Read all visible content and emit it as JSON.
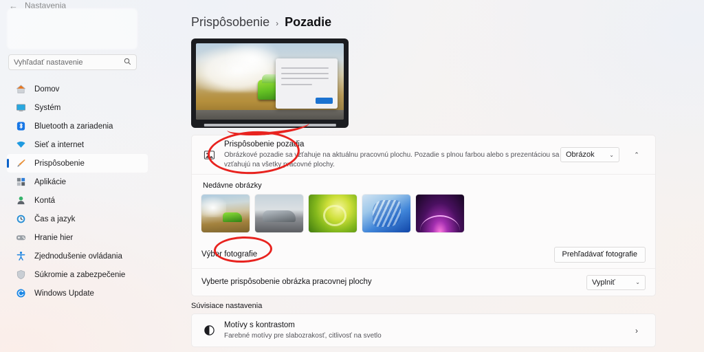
{
  "window": {
    "title": "Nastavenia",
    "back_icon": "back-arrow-icon"
  },
  "sidebar": {
    "search": {
      "placeholder": "Vyhľadať nastavenie",
      "value": "",
      "icon": "search-icon"
    },
    "items": [
      {
        "label": "Domov",
        "icon": "home-icon",
        "selected": false
      },
      {
        "label": "Systém",
        "icon": "monitor-icon",
        "selected": false
      },
      {
        "label": "Bluetooth a zariadenia",
        "icon": "bluetooth-icon",
        "selected": false
      },
      {
        "label": "Sieť a internet",
        "icon": "wifi-icon",
        "selected": false
      },
      {
        "label": "Prispôsobenie",
        "icon": "paintbrush-icon",
        "selected": true
      },
      {
        "label": "Aplikácie",
        "icon": "apps-icon",
        "selected": false
      },
      {
        "label": "Kontá",
        "icon": "person-icon",
        "selected": false
      },
      {
        "label": "Čas a jazyk",
        "icon": "clock-icon",
        "selected": false
      },
      {
        "label": "Hranie hier",
        "icon": "gamepad-icon",
        "selected": false
      },
      {
        "label": "Zjednodušenie ovládania",
        "icon": "accessibility-icon",
        "selected": false
      },
      {
        "label": "Súkromie a zabezpečenie",
        "icon": "shield-icon",
        "selected": false
      },
      {
        "label": "Windows Update",
        "icon": "update-icon",
        "selected": false
      }
    ]
  },
  "breadcrumb": {
    "parent": "Prispôsobenie",
    "separator": "›",
    "current": "Pozadie"
  },
  "preview": {
    "name": "desktop-background-preview"
  },
  "background_settings": {
    "title": "Prispôsobenie pozadia",
    "description": "Obrázkové pozadie sa vzťahuje na aktuálnu pracovnú plochu. Pozadie s plnou farbou alebo s prezentáciou sa vzťahujú na všetky pracovné plochy.",
    "icon": "picture-icon",
    "dropdown_value": "Obrázok",
    "dropdown_chevron": "⌄",
    "expander_chevron": "⌃"
  },
  "recent_images": {
    "label": "Nedávne obrázky",
    "thumbnails": [
      {
        "name": "thumbnail-green-car-smoke"
      },
      {
        "name": "thumbnail-silver-car"
      },
      {
        "name": "thumbnail-green-abstract"
      },
      {
        "name": "thumbnail-windows11-blue-bloom"
      },
      {
        "name": "thumbnail-purple-glow"
      }
    ]
  },
  "choose_photo": {
    "label": "Výber fotografie",
    "button_label": "Prehľadávať fotografie"
  },
  "fit_setting": {
    "label": "Vyberte prispôsobenie obrázka pracovnej plochy",
    "dropdown_value": "Vyplniť",
    "dropdown_chevron": "⌄"
  },
  "related_settings": {
    "section_label": "Súvisiace nastavenia",
    "items": [
      {
        "title": "Motívy s kontrastom",
        "description": "Farebné motívy pre slabozrakosť, citlivosť na svetlo",
        "icon": "contrast-icon",
        "chevron": "›"
      }
    ]
  },
  "annotations": {
    "color": "#e8231f",
    "shapes": [
      {
        "name": "annotation-ellipse-background-personalization"
      },
      {
        "name": "annotation-ellipse-choose-photo"
      },
      {
        "name": "annotation-arc-preview"
      }
    ]
  }
}
